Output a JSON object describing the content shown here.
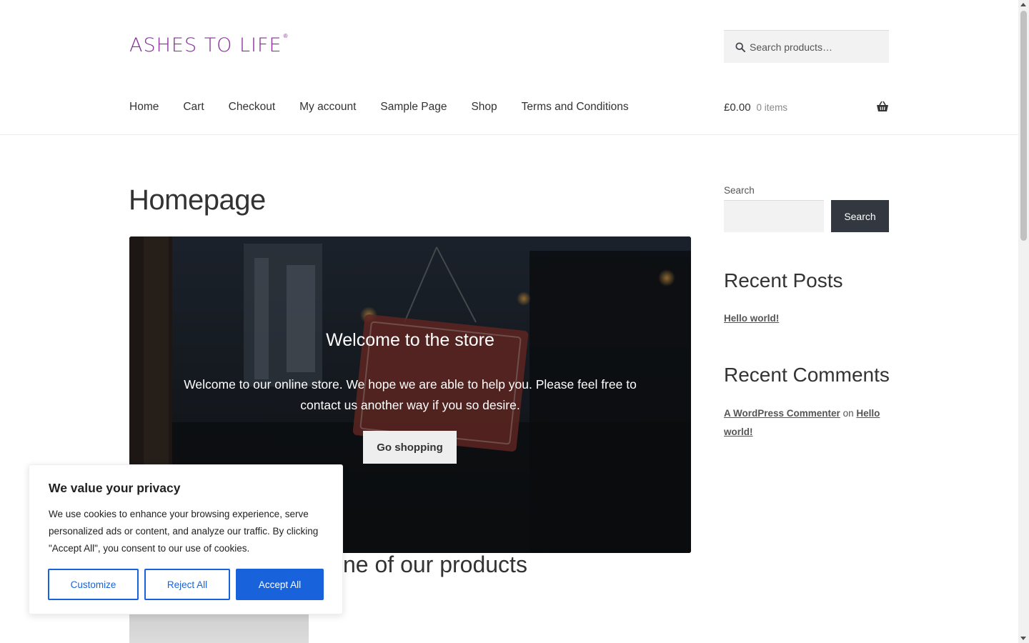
{
  "header": {
    "logo_text": "ASHES TO LIFE",
    "logo_mark": "®",
    "search_placeholder": "Search products…"
  },
  "nav": {
    "items": [
      "Home",
      "Cart",
      "Checkout",
      "My account",
      "Sample Page",
      "Shop",
      "Terms and Conditions"
    ]
  },
  "cart": {
    "amount": "£0.00",
    "count": "0 items"
  },
  "main": {
    "page_title": "Homepage",
    "hero": {
      "title": "Welcome to the store",
      "text": "Welcome to our online store. We hope we are able to help you. Please feel free to contact us another way if you so desire.",
      "button": "Go shopping"
    },
    "section_heading": "ne of our products"
  },
  "sidebar": {
    "search_label": "Search",
    "search_button": "Search",
    "recent_posts_heading": "Recent Posts",
    "recent_posts": [
      "Hello world!"
    ],
    "recent_comments_heading": "Recent Comments",
    "comment": {
      "author": "A WordPress Commenter",
      "on": "on",
      "post": "Hello world!"
    }
  },
  "cookie_banner": {
    "title": "We value your privacy",
    "text": "We use cookies to enhance your browsing experience, serve personalized ads or content, and analyze our traffic. By clicking \"Accept All\", you consent to our use of cookies.",
    "customize": "Customize",
    "reject": "Reject All",
    "accept": "Accept All"
  },
  "colors": {
    "brand": "#8b2c9e",
    "accent_blue": "#1863dc",
    "dark_button": "#333740"
  }
}
